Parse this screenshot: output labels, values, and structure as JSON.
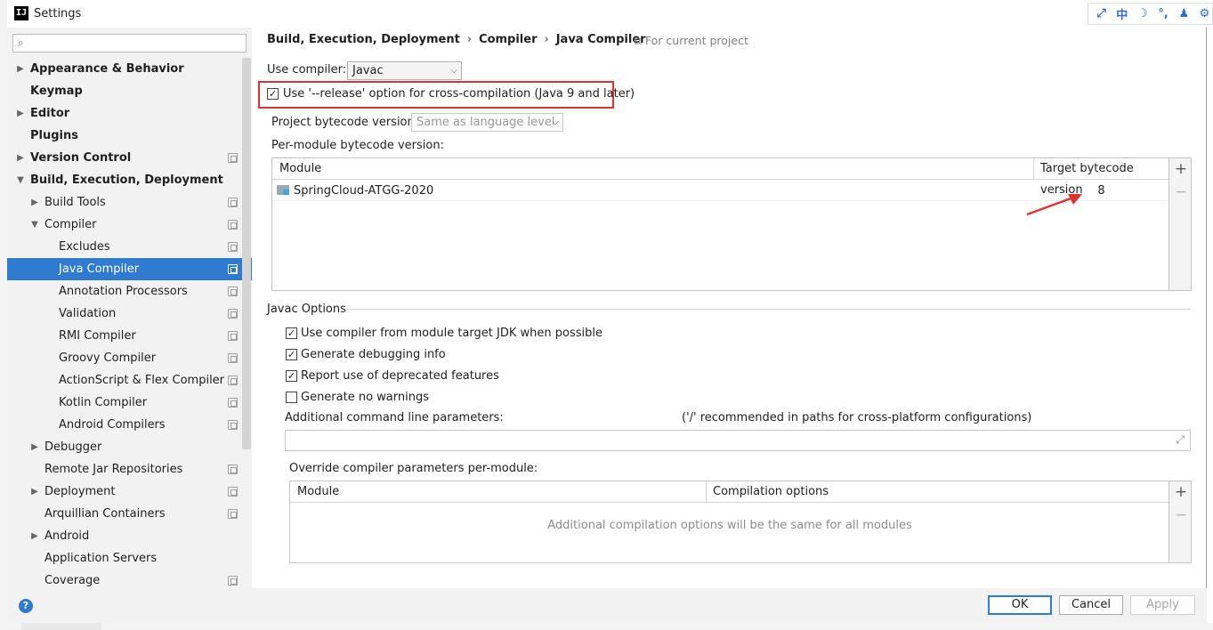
{
  "window": {
    "title": "Settings",
    "app_icon": "IJ"
  },
  "ime": {
    "items": [
      "⤢",
      "中",
      "☽",
      "°,",
      "♟",
      "⚙"
    ]
  },
  "sidebar": {
    "search_placeholder": "",
    "items": [
      {
        "label": "Appearance & Behavior",
        "level": 0,
        "bold": true,
        "arrow": "▶",
        "proj": false,
        "selected": false
      },
      {
        "label": "Keymap",
        "level": 0,
        "bold": true,
        "arrow": "",
        "proj": false,
        "selected": false
      },
      {
        "label": "Editor",
        "level": 0,
        "bold": true,
        "arrow": "▶",
        "proj": false,
        "selected": false
      },
      {
        "label": "Plugins",
        "level": 0,
        "bold": true,
        "arrow": "",
        "proj": false,
        "selected": false
      },
      {
        "label": "Version Control",
        "level": 0,
        "bold": true,
        "arrow": "▶",
        "proj": true,
        "selected": false
      },
      {
        "label": "Build, Execution, Deployment",
        "level": 0,
        "bold": true,
        "arrow": "▼",
        "proj": false,
        "selected": false
      },
      {
        "label": "Build Tools",
        "level": 1,
        "bold": false,
        "arrow": "▶",
        "proj": true,
        "selected": false
      },
      {
        "label": "Compiler",
        "level": 1,
        "bold": false,
        "arrow": "▼",
        "proj": true,
        "selected": false
      },
      {
        "label": "Excludes",
        "level": 2,
        "bold": false,
        "arrow": "",
        "proj": true,
        "selected": false
      },
      {
        "label": "Java Compiler",
        "level": 2,
        "bold": false,
        "arrow": "",
        "proj": true,
        "selected": true
      },
      {
        "label": "Annotation Processors",
        "level": 2,
        "bold": false,
        "arrow": "",
        "proj": true,
        "selected": false
      },
      {
        "label": "Validation",
        "level": 2,
        "bold": false,
        "arrow": "",
        "proj": true,
        "selected": false
      },
      {
        "label": "RMI Compiler",
        "level": 2,
        "bold": false,
        "arrow": "",
        "proj": true,
        "selected": false
      },
      {
        "label": "Groovy Compiler",
        "level": 2,
        "bold": false,
        "arrow": "",
        "proj": true,
        "selected": false
      },
      {
        "label": "ActionScript & Flex Compiler",
        "level": 2,
        "bold": false,
        "arrow": "",
        "proj": true,
        "selected": false
      },
      {
        "label": "Kotlin Compiler",
        "level": 2,
        "bold": false,
        "arrow": "",
        "proj": true,
        "selected": false
      },
      {
        "label": "Android Compilers",
        "level": 2,
        "bold": false,
        "arrow": "",
        "proj": true,
        "selected": false
      },
      {
        "label": "Debugger",
        "level": 1,
        "bold": false,
        "arrow": "▶",
        "proj": false,
        "selected": false
      },
      {
        "label": "Remote Jar Repositories",
        "level": 1,
        "bold": false,
        "arrow": "",
        "proj": true,
        "selected": false
      },
      {
        "label": "Deployment",
        "level": 1,
        "bold": false,
        "arrow": "▶",
        "proj": true,
        "selected": false
      },
      {
        "label": "Arquillian Containers",
        "level": 1,
        "bold": false,
        "arrow": "",
        "proj": true,
        "selected": false
      },
      {
        "label": "Android",
        "level": 1,
        "bold": false,
        "arrow": "▶",
        "proj": false,
        "selected": false
      },
      {
        "label": "Application Servers",
        "level": 1,
        "bold": false,
        "arrow": "",
        "proj": false,
        "selected": false
      },
      {
        "label": "Coverage",
        "level": 1,
        "bold": false,
        "arrow": "",
        "proj": true,
        "selected": false
      }
    ]
  },
  "breadcrumb": {
    "parts": [
      "Build, Execution, Deployment",
      "Compiler",
      "Java Compiler"
    ],
    "separator": "›",
    "scope": "For current project"
  },
  "compiler": {
    "use_compiler_label": "Use compiler:",
    "use_compiler_value": "Javac",
    "release_option_label": "Use '--release' option for cross-compilation (Java 9 and later)",
    "release_option_checked": true,
    "project_bytecode_label": "Project bytecode version:",
    "project_bytecode_value": "Same as language level",
    "per_module_label": "Per-module bytecode version:"
  },
  "module_table": {
    "columns": [
      "Module",
      "Target bytecode version"
    ],
    "rows": [
      {
        "module": "SpringCloud-ATGG-2020",
        "target": "8"
      }
    ],
    "add_label": "+",
    "remove_label": "−"
  },
  "javac": {
    "section_title": "Javac Options",
    "options": [
      {
        "label": "Use compiler from module target JDK when possible",
        "checked": true
      },
      {
        "label": "Generate debugging info",
        "checked": true
      },
      {
        "label": "Report use of deprecated features",
        "checked": true
      },
      {
        "label": "Generate no warnings",
        "checked": false
      }
    ],
    "cmd_params_label": "Additional command line parameters:",
    "cmd_params_hint": "('/' recommended in paths for cross-platform configurations)",
    "cmd_params_value": "",
    "override_label": "Override compiler parameters per-module:",
    "override_columns": [
      "Module",
      "Compilation options"
    ],
    "override_empty": "Additional compilation options will be the same for all modules"
  },
  "buttons": {
    "ok": "OK",
    "cancel": "Cancel",
    "apply": "Apply",
    "help": "?"
  },
  "colors": {
    "accent": "#2f7bd0",
    "highlight": "#e0312f"
  }
}
